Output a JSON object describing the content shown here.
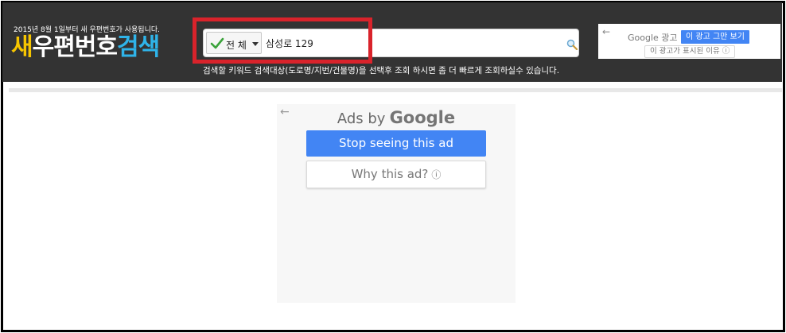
{
  "header": {
    "tagline": "2015년 8월 1일부터 새 우편번호가 사용됩니다.",
    "logo": {
      "part1": "새",
      "part2": "우편번호",
      "part3": "검색"
    },
    "hint": "검색할 키워드 검색대상(도로명/지번/건물명)을 선택후 조회 하시면 좀 더 빠르게 조회하실수 있습니다."
  },
  "search": {
    "scope_label": "전 체",
    "query": "삼성로 129"
  },
  "top_ad": {
    "google_label": "Google 광고",
    "stop_label": "이 광고 그만 보기",
    "why_label": "이 광고가 표시된 이유 ⓘ"
  },
  "ad_panel": {
    "ads_by": "Ads by",
    "google": "Google",
    "stop_button": "Stop seeing this ad",
    "why_button": "Why this ad?",
    "info_glyph": "ⓘ"
  },
  "colors": {
    "header_bg": "#333333",
    "logo_yellow": "#f6c500",
    "logo_blue": "#2fb4e9",
    "highlight_red": "#d9232b",
    "google_blue": "#4285f4"
  }
}
